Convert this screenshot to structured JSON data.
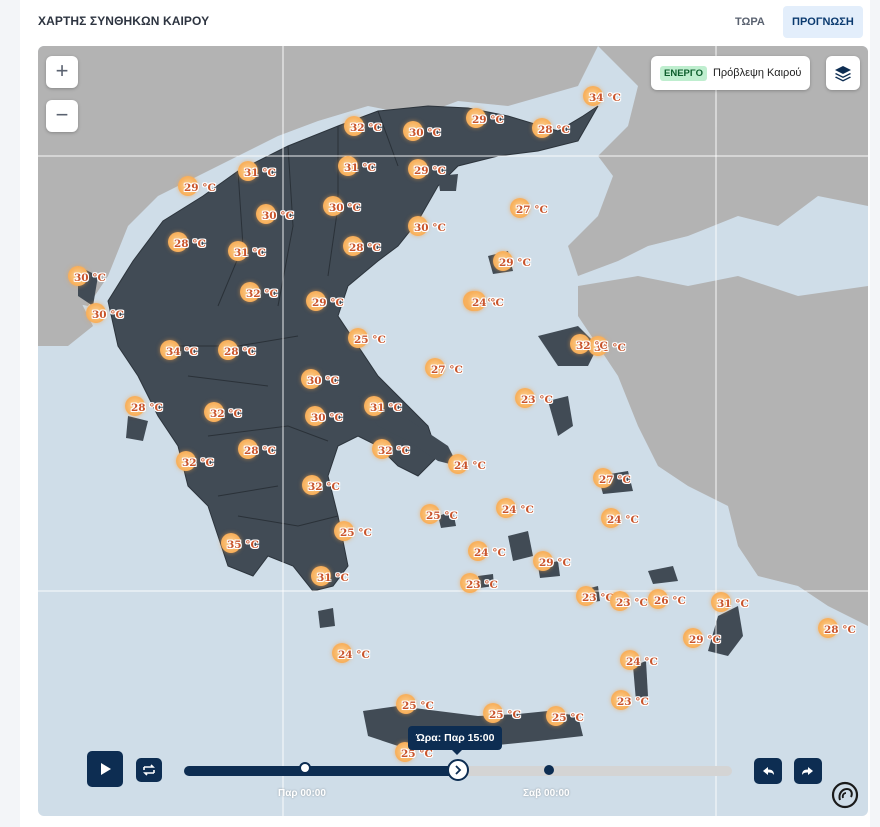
{
  "header": {
    "title": "ΧΑΡΤΗΣ ΣΥΝΘΗΚΩΝ ΚΑΙΡΟΥ"
  },
  "tabs": [
    {
      "label": "ΤΩΡΑ"
    },
    {
      "label": "ΠΡΟΓΝΩΣΗ"
    }
  ],
  "active_tab": "ΠΡΟΓΝΩΣΗ",
  "map": {
    "zoom_in": "+",
    "zoom_out": "−",
    "layer": {
      "badge": "ΕΝΕΡΓΟ",
      "label": "Πρόβλεψη Καιρού"
    },
    "colors": {
      "sea": "#cfdde8",
      "land_greece": "#414b55",
      "land_other": "#b3b3b3",
      "accent": "#0d2d52",
      "temp_text": "#c9542b"
    }
  },
  "markers": [
    {
      "t": "34 °C"
    },
    {
      "t": "32 °C"
    },
    {
      "t": "30 °C"
    },
    {
      "t": "29 °C"
    },
    {
      "t": "28 °C"
    },
    {
      "t": "29 °C"
    },
    {
      "t": "31 °C"
    },
    {
      "t": "31 °C"
    },
    {
      "t": "29 °C"
    },
    {
      "t": "30 °C"
    },
    {
      "t": "30 °C"
    },
    {
      "t": "27 °C"
    },
    {
      "t": "30 °C"
    },
    {
      "t": "28 °C"
    },
    {
      "t": "31 °C"
    },
    {
      "t": "28 °C"
    },
    {
      "t": "29 °C"
    },
    {
      "t": "30 °C"
    },
    {
      "t": "34 °C"
    },
    {
      "t": "30 °C"
    },
    {
      "t": "29 °C"
    },
    {
      "t": "29 °C"
    },
    {
      "t": "24 °C"
    },
    {
      "t": "25 °C"
    },
    {
      "t": "34 °C"
    },
    {
      "t": "28 °C"
    },
    {
      "t": "32 °C"
    },
    {
      "t": "30 °C"
    },
    {
      "t": "27 °C"
    },
    {
      "t": "28 °C"
    },
    {
      "t": "32 °C"
    },
    {
      "t": "31 °C"
    },
    {
      "t": "23 °C"
    },
    {
      "t": "30 °C"
    },
    {
      "t": "28 °C"
    },
    {
      "t": "32 °C"
    },
    {
      "t": "32 °C"
    },
    {
      "t": "24 °C"
    },
    {
      "t": "32 °C"
    },
    {
      "t": "27 °C"
    },
    {
      "t": "32 °C"
    },
    {
      "t": "24 °C"
    },
    {
      "t": "25 °C"
    },
    {
      "t": "24 °C"
    },
    {
      "t": "35 °C"
    },
    {
      "t": "25 °C"
    },
    {
      "t": "24 °C"
    },
    {
      "t": "23 °C"
    },
    {
      "t": "29 °C"
    },
    {
      "t": "31 °C"
    },
    {
      "t": "23 °C"
    },
    {
      "t": "23 °C"
    },
    {
      "t": "26 °C"
    },
    {
      "t": "31 °C"
    },
    {
      "t": "29 °C"
    },
    {
      "t": "28 °C"
    },
    {
      "t": "24 °C"
    },
    {
      "t": "24 °C"
    },
    {
      "t": "25 °C"
    },
    {
      "t": "23 °C"
    },
    {
      "t": "25 °C"
    },
    {
      "t": "25 °C"
    },
    {
      "t": "25 °C"
    }
  ],
  "timeline": {
    "tooltip": "Ώρα: Παρ 15:00",
    "labels": [
      "Παρ 00:00",
      "Σαβ 00:00"
    ],
    "progress": 0.5
  }
}
